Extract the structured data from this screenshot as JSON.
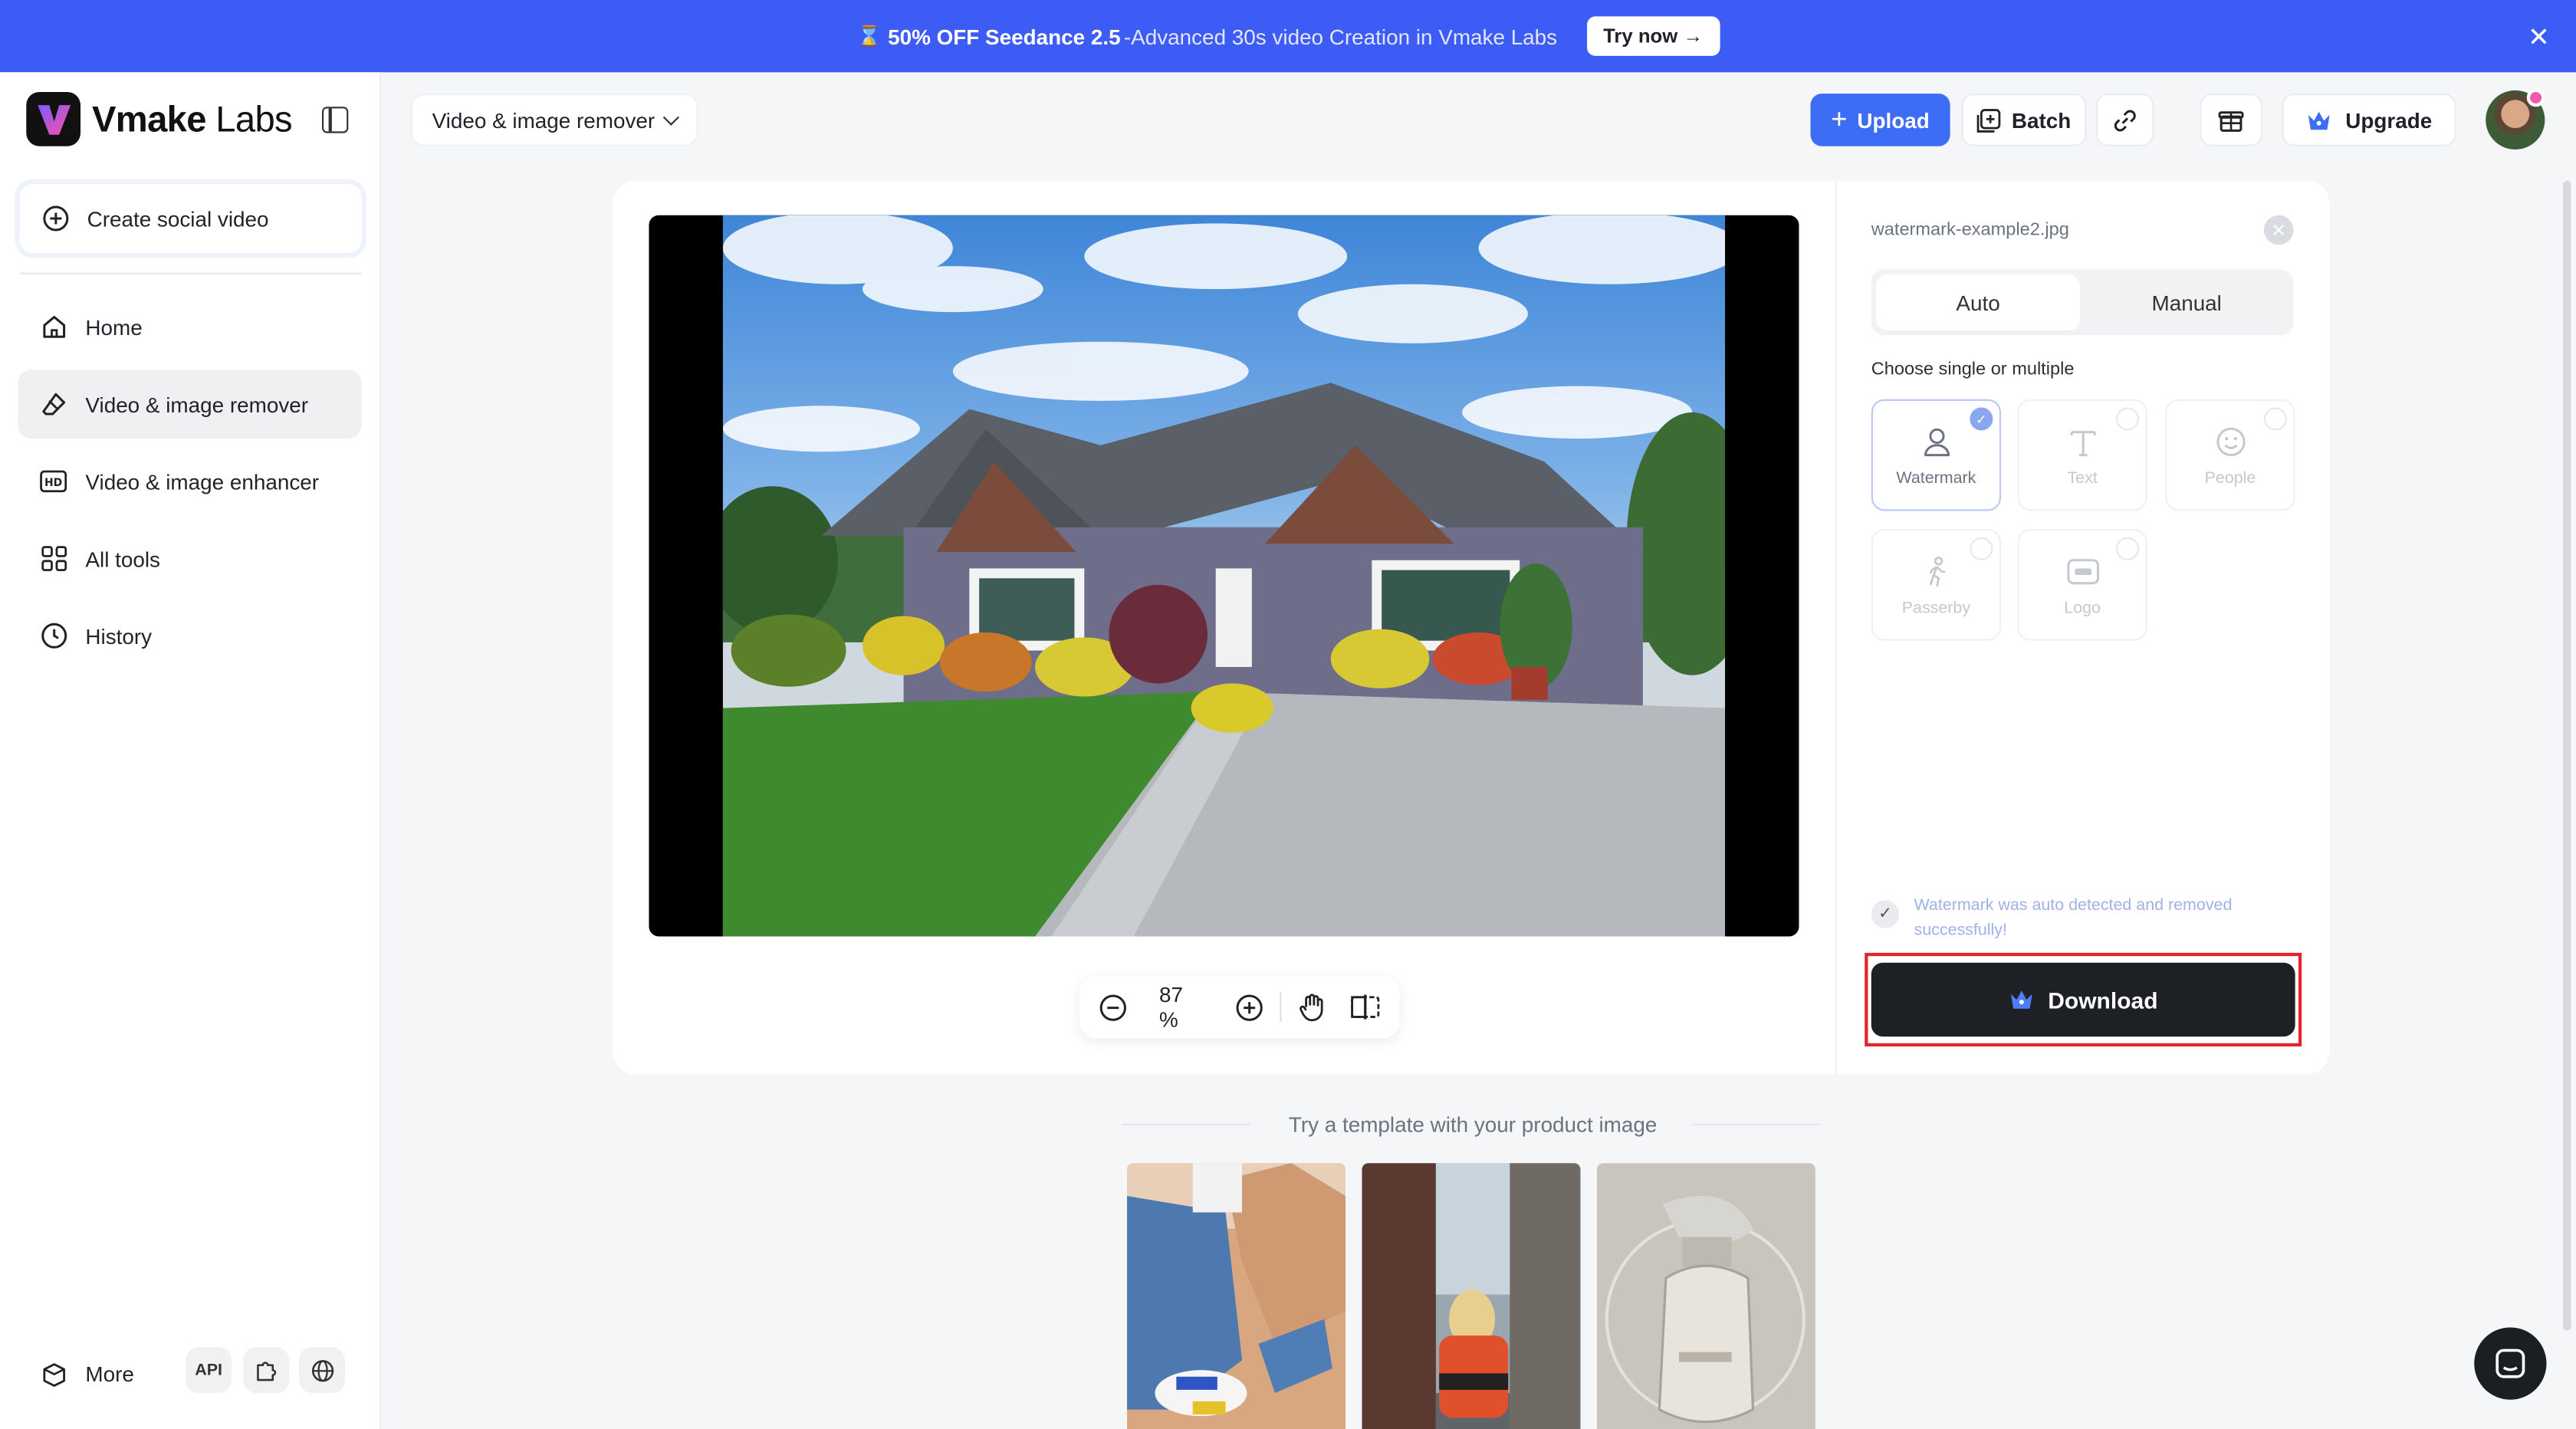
{
  "promo": {
    "icon": "hourglass-icon",
    "headline": "50% OFF Seedance 2.5",
    "detail": "-Advanced 30s video Creation in Vmake Labs",
    "cta": "Try now →"
  },
  "brand": {
    "name": "Vmake",
    "suffix": "Labs"
  },
  "sidebar": {
    "create_label": "Create social video",
    "items": [
      {
        "label": "Home",
        "icon": "home-icon"
      },
      {
        "label": "Video & image remover",
        "icon": "eraser-icon",
        "active": true
      },
      {
        "label": "Video & image enhancer",
        "icon": "hd-icon"
      },
      {
        "label": "All tools",
        "icon": "grid-icon"
      },
      {
        "label": "History",
        "icon": "clock-icon"
      }
    ],
    "more_label": "More",
    "api_label": "API"
  },
  "toolbar": {
    "tool_select": "Video & image remover",
    "upload_label": "Upload",
    "batch_label": "Batch",
    "upgrade_label": "Upgrade"
  },
  "viewer": {
    "zoom": "87 %"
  },
  "panel": {
    "filename": "watermark-example2.jpg",
    "tabs": [
      "Auto",
      "Manual"
    ],
    "active_tab": "Auto",
    "choose_label": "Choose single or multiple",
    "options": [
      {
        "label": "Watermark",
        "selected": true
      },
      {
        "label": "Text",
        "selected": false
      },
      {
        "label": "People",
        "selected": false
      },
      {
        "label": "Passerby",
        "selected": false
      },
      {
        "label": "Logo",
        "selected": false
      }
    ],
    "success_text": "Watermark was auto detected and removed successfully!",
    "download_label": "Download"
  },
  "templates": {
    "title": "Try a template with your product image"
  },
  "colors": {
    "promo_bg": "#3d5cf5",
    "accent": "#3d6cf5",
    "download_bg": "#1d2126",
    "highlight_border": "#e0272d"
  }
}
